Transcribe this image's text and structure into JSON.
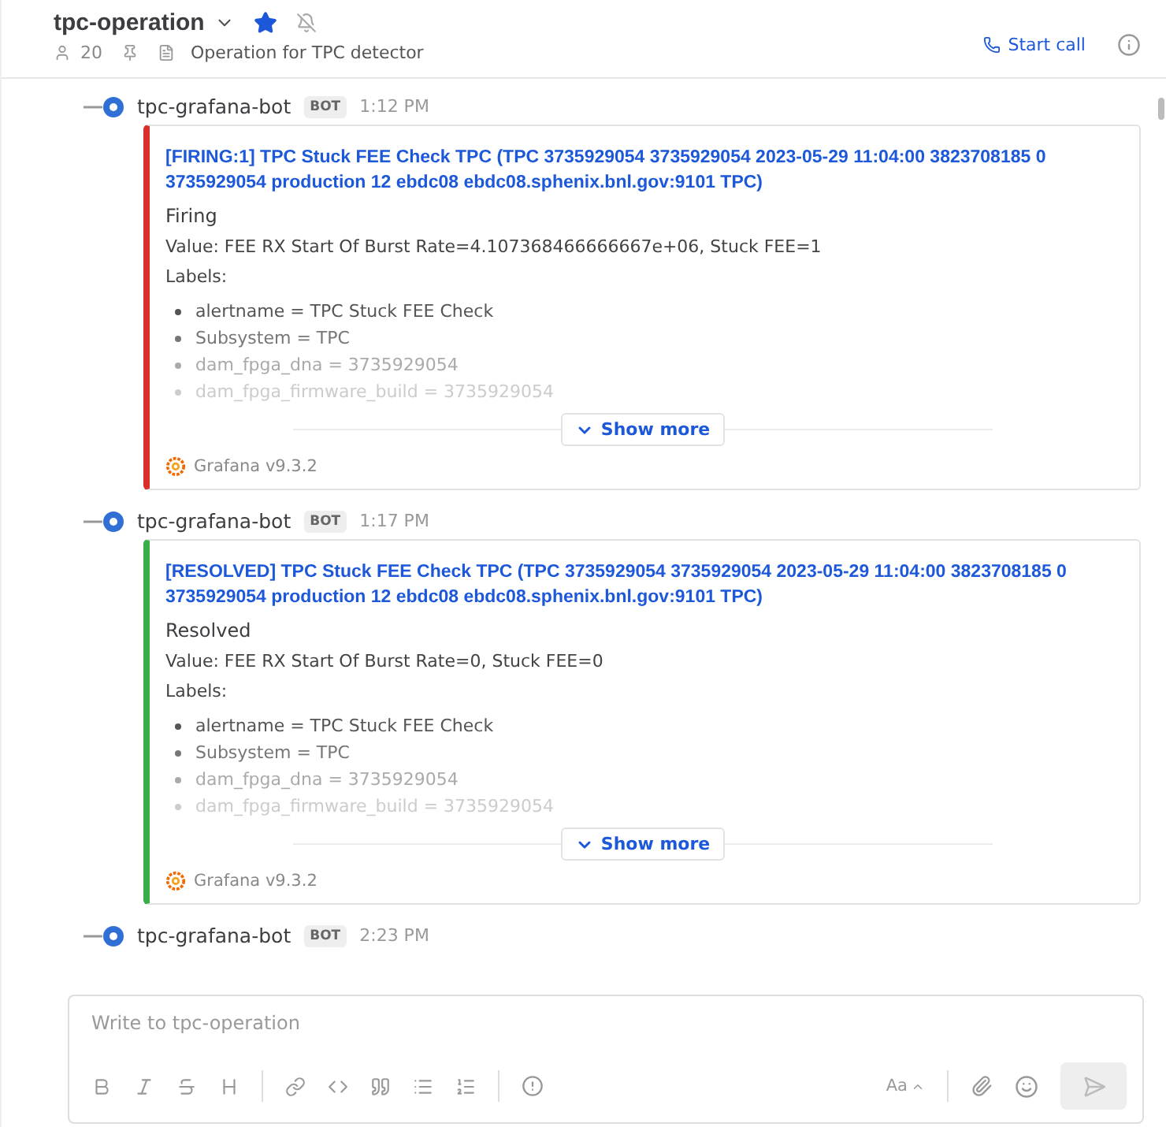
{
  "channel": {
    "name": "tpc-operation",
    "starred": true,
    "muted": true,
    "member_count": "20",
    "topic": "Operation for TPC detector"
  },
  "call_button": "Start call",
  "messages": [
    {
      "author": "tpc-grafana-bot",
      "badge": "BOT",
      "time": "1:12 PM",
      "attachment": {
        "color": "#d9302c",
        "title": "[FIRING:1] TPC Stuck FEE Check TPC (TPC 3735929054 3735929054 2023-05-29 11:04:00 3823708185 0 3735929054 production 12 ebdc08 ebdc08.sphenix.bnl.gov:9101 TPC)",
        "status_text": "Firing",
        "value": "Value: FEE RX Start Of Burst Rate=4.107368466666667e+06, Stuck FEE=1",
        "labels_heading": "Labels:",
        "labels": [
          "alertname = TPC Stuck FEE Check",
          "Subsystem = TPC",
          "dam_fpga_dna = 3735929054",
          "dam_fpga_firmware_build = 3735929054"
        ],
        "show_more": "Show more",
        "footer": "Grafana v9.3.2"
      }
    },
    {
      "author": "tpc-grafana-bot",
      "badge": "BOT",
      "time": "1:17 PM",
      "attachment": {
        "color": "#3aae4b",
        "title": "[RESOLVED] TPC Stuck FEE Check TPC (TPC 3735929054 3735929054 2023-05-29 11:04:00 3823708185 0 3735929054 production 12 ebdc08 ebdc08.sphenix.bnl.gov:9101 TPC)",
        "status_text": "Resolved",
        "value": "Value: FEE RX Start Of Burst Rate=0, Stuck FEE=0",
        "labels_heading": "Labels:",
        "labels": [
          "alertname = TPC Stuck FEE Check",
          "Subsystem = TPC",
          "dam_fpga_dna = 3735929054",
          "dam_fpga_firmware_build = 3735929054"
        ],
        "show_more": "Show more",
        "footer": "Grafana v9.3.2"
      }
    },
    {
      "author": "tpc-grafana-bot",
      "badge": "BOT",
      "time": "2:23 PM"
    }
  ],
  "composer": {
    "placeholder": "Write to tpc-operation",
    "format_button": "Aa"
  }
}
